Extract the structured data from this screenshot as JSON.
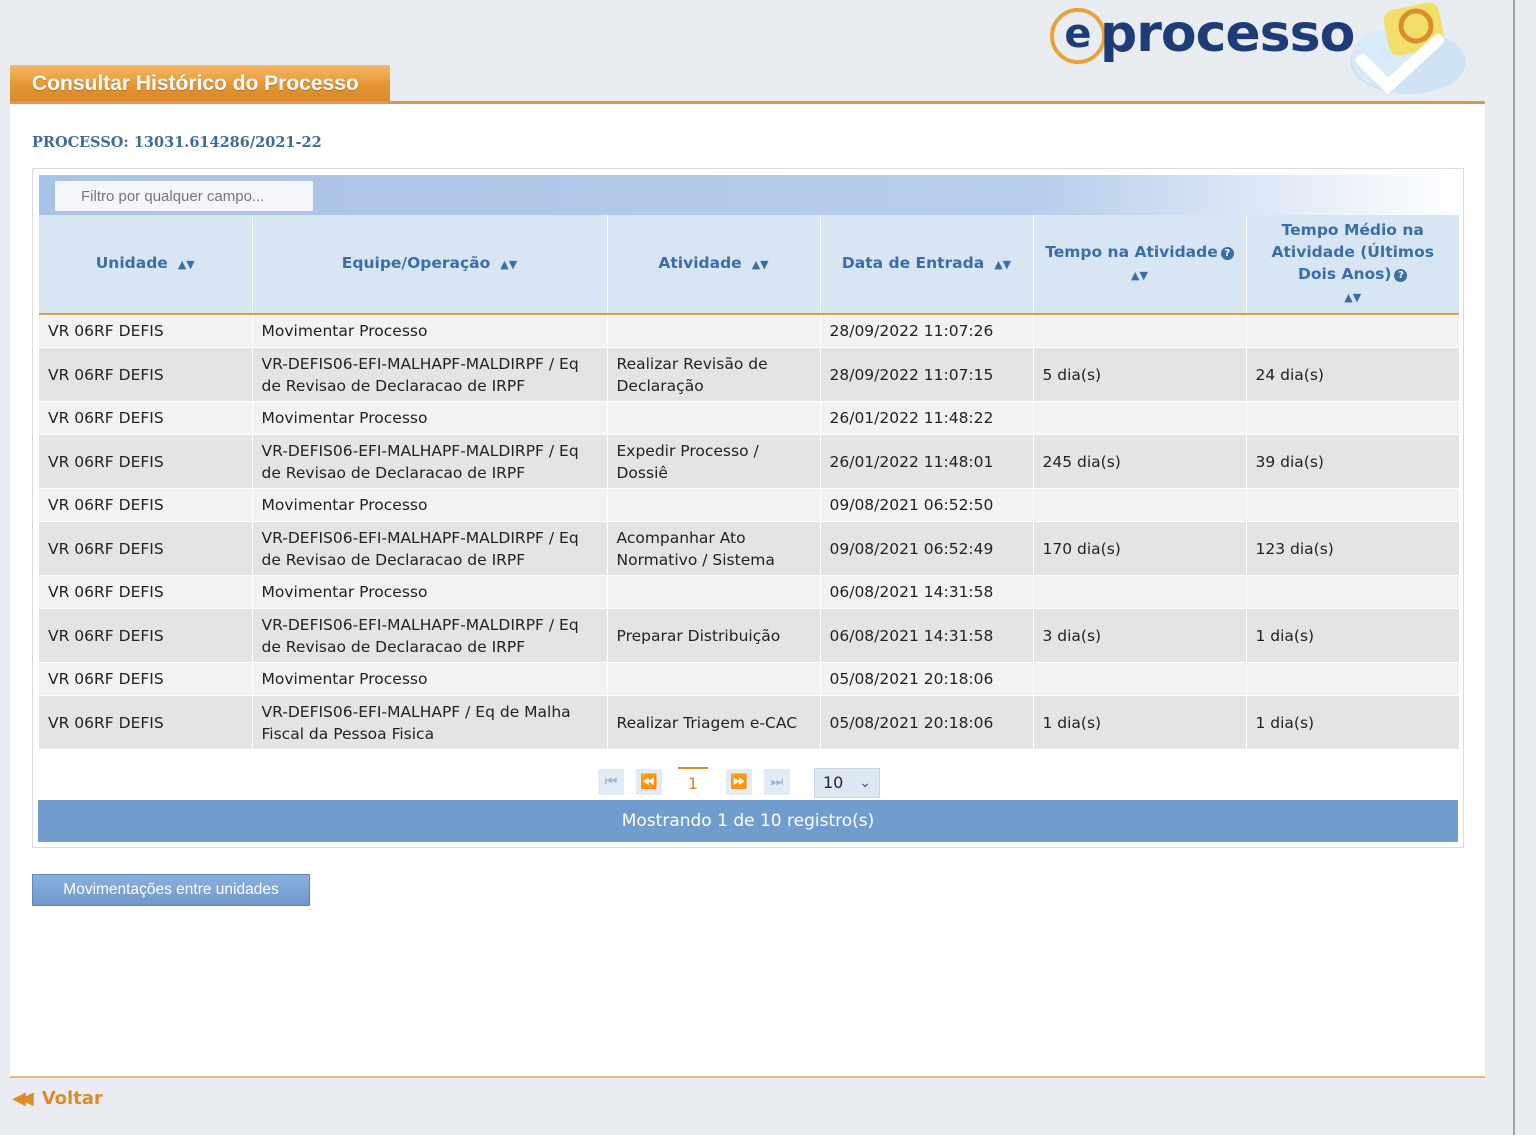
{
  "header": {
    "title": "Consultar Histórico do Processo",
    "logo_text": "processo",
    "logo_mark": "e"
  },
  "process": {
    "label": "PROCESSO: 13031.614286/2021-22"
  },
  "filter": {
    "placeholder": "Filtro por qualquer campo..."
  },
  "table": {
    "columns": [
      {
        "label": "Unidade",
        "help": false
      },
      {
        "label": "Equipe/Operação",
        "help": false
      },
      {
        "label": "Atividade",
        "help": false
      },
      {
        "label": "Data de Entrada",
        "help": false
      },
      {
        "label": "Tempo na Atividade",
        "help": true
      },
      {
        "label": "Tempo Médio na Atividade (Últimos Dois Anos)",
        "help": true
      }
    ],
    "rows": [
      [
        "VR 06RF DEFIS",
        "Movimentar Processo",
        "",
        "28/09/2022 11:07:26",
        "",
        ""
      ],
      [
        "VR 06RF DEFIS",
        "VR-DEFIS06-EFI-MALHAPF-MALDIRPF / Eq de Revisao de Declaracao de IRPF",
        "Realizar Revisão de Declaração",
        "28/09/2022 11:07:15",
        "5 dia(s)",
        "24 dia(s)"
      ],
      [
        "VR 06RF DEFIS",
        "Movimentar Processo",
        "",
        "26/01/2022 11:48:22",
        "",
        ""
      ],
      [
        "VR 06RF DEFIS",
        "VR-DEFIS06-EFI-MALHAPF-MALDIRPF / Eq de Revisao de Declaracao de IRPF",
        "Expedir Processo / Dossiê",
        "26/01/2022 11:48:01",
        "245 dia(s)",
        "39 dia(s)"
      ],
      [
        "VR 06RF DEFIS",
        "Movimentar Processo",
        "",
        "09/08/2021 06:52:50",
        "",
        ""
      ],
      [
        "VR 06RF DEFIS",
        "VR-DEFIS06-EFI-MALHAPF-MALDIRPF / Eq de Revisao de Declaracao de IRPF",
        "Acompanhar Ato Normativo / Sistema",
        "09/08/2021 06:52:49",
        "170 dia(s)",
        "123 dia(s)"
      ],
      [
        "VR 06RF DEFIS",
        "Movimentar Processo",
        "",
        "06/08/2021 14:31:58",
        "",
        ""
      ],
      [
        "VR 06RF DEFIS",
        "VR-DEFIS06-EFI-MALHAPF-MALDIRPF / Eq de Revisao de Declaracao de IRPF",
        "Preparar Distribuição",
        "06/08/2021 14:31:58",
        "3 dia(s)",
        "1 dia(s)"
      ],
      [
        "VR 06RF DEFIS",
        "Movimentar Processo",
        "",
        "05/08/2021 20:18:06",
        "",
        ""
      ],
      [
        "VR 06RF DEFIS",
        "VR-DEFIS06-EFI-MALHAPF / Eq de Malha Fiscal da Pessoa Fisica",
        "Realizar Triagem e-CAC",
        "05/08/2021 20:18:06",
        "1 dia(s)",
        "1 dia(s)"
      ]
    ]
  },
  "pager": {
    "current_page": "1",
    "page_size": "10",
    "first_icon": "first-page-icon",
    "prev_icon": "previous-page-icon",
    "next_icon": "next-page-icon",
    "last_icon": "last-page-icon"
  },
  "status": {
    "text": "Mostrando 1 de 10 registro(s)"
  },
  "actions": {
    "movements_label": "Movimentações entre unidades"
  },
  "footer": {
    "back_label": "Voltar"
  },
  "colors": {
    "accent_orange": "#e59533",
    "header_blue": "#3b6ea6",
    "status_bar": "#709cce"
  }
}
